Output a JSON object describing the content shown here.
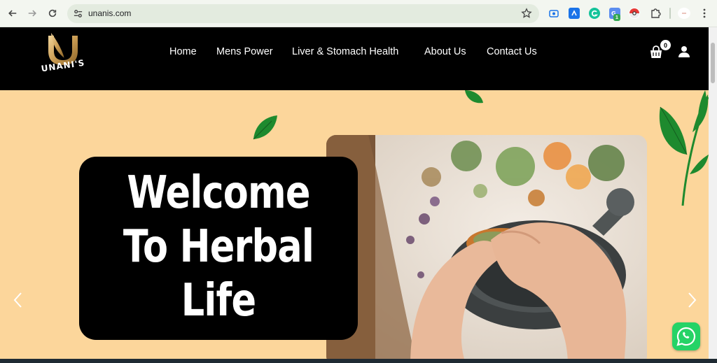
{
  "browser": {
    "url": "unanis.com",
    "extension_badge": "1"
  },
  "site": {
    "logo_letter": "U",
    "logo_name": "UNANI'S",
    "nav": [
      {
        "label": "Home"
      },
      {
        "label": "Mens Power"
      },
      {
        "label": "Liver & Stomach Health"
      },
      {
        "label": "About Us"
      },
      {
        "label": "Contact Us"
      }
    ],
    "cart_count": "0"
  },
  "hero": {
    "line1": "Welcome",
    "line2": "To Herbal",
    "line3": "Life",
    "background_color": "#fcd69b"
  },
  "colors": {
    "header_bg": "#000000",
    "leaf_green": "#1e8a2e",
    "whatsapp_green": "#25d366"
  },
  "icons": [
    "back-icon",
    "forward-icon",
    "reload-icon",
    "site-settings-icon",
    "bookmark-star-icon",
    "cart-icon",
    "user-icon",
    "chevron-left-icon",
    "chevron-right-icon",
    "whatsapp-icon",
    "menu-dots-icon"
  ]
}
